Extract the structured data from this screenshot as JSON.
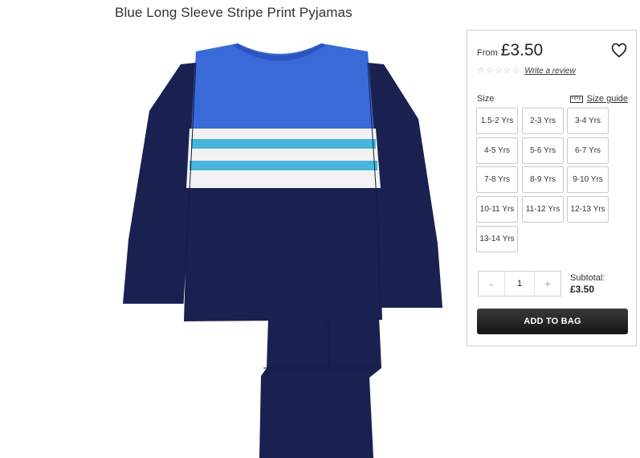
{
  "product": {
    "title": "Blue Long Sleeve Stripe Print Pyjamas",
    "image_icon": "pyjamas-product-image",
    "colors": {
      "navy": "#1a2151",
      "royal_blue": "#3a6ad8",
      "stripe_white": "#f2f2f2",
      "stripe_aqua": "#48b6dc"
    }
  },
  "purchase": {
    "price_prefix": "From",
    "price": "£3.50",
    "wishlist_icon": "heart-icon",
    "rating": {
      "stars": 0,
      "max_stars": 5,
      "review_link": "Write a review"
    },
    "size": {
      "label": "Size",
      "guide_icon": "ruler-icon",
      "guide_label": "Size guide",
      "options": [
        "1.5-2 Yrs",
        "2-3 Yrs",
        "3-4 Yrs",
        "4-5 Yrs",
        "5-6 Yrs",
        "6-7 Yrs",
        "7-8 Yrs",
        "8-9 Yrs",
        "9-10 Yrs",
        "10-11 Yrs",
        "11-12 Yrs",
        "12-13 Yrs",
        "13-14 Yrs"
      ]
    },
    "quantity": {
      "minus": "-",
      "value": "1",
      "plus": "+"
    },
    "subtotal": {
      "label": "Subtotal:",
      "value": "£3.50"
    },
    "add_to_bag_label": "ADD TO BAG",
    "button_color": "#1e1e1e"
  }
}
